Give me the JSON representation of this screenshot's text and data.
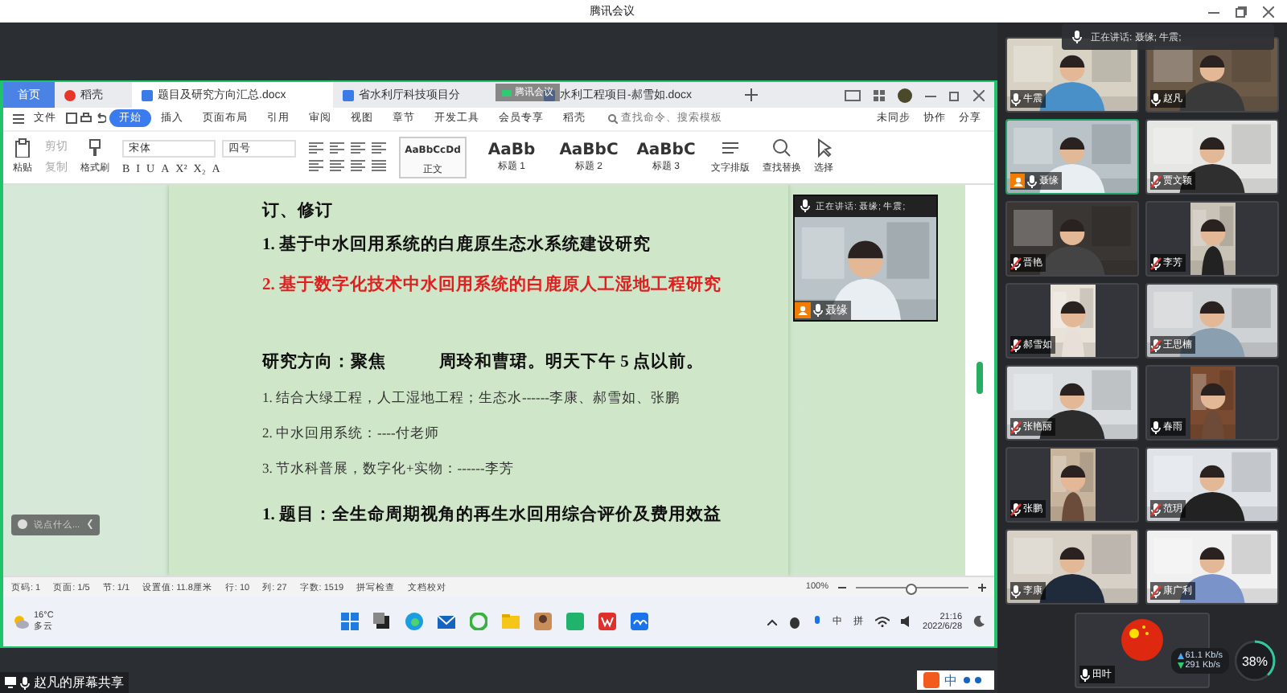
{
  "app": {
    "title": "腾讯会议"
  },
  "wps": {
    "tabs": [
      {
        "label": "首页",
        "kind": "home",
        "selected": false
      },
      {
        "label": "稻壳",
        "kind": "docer",
        "selected": false
      },
      {
        "label": "题目及研究方向汇总.docx",
        "kind": "doc",
        "selected": true
      },
      {
        "label": "省水利厅科技项目分",
        "kind": "doc",
        "selected": false
      },
      {
        "label": "水利工程项目-郝雪如.docx",
        "kind": "doc",
        "selected": false
      }
    ],
    "floating_badge": "腾讯会议",
    "file_menu": "文件",
    "menu": [
      {
        "label": "开始",
        "selected": true
      },
      {
        "label": "插入",
        "selected": false
      },
      {
        "label": "页面布局",
        "selected": false
      },
      {
        "label": "引用",
        "selected": false
      },
      {
        "label": "审阅",
        "selected": false
      },
      {
        "label": "视图",
        "selected": false
      },
      {
        "label": "章节",
        "selected": false
      },
      {
        "label": "开发工具",
        "selected": false
      },
      {
        "label": "会员专享",
        "selected": false
      },
      {
        "label": "稻壳",
        "selected": false
      }
    ],
    "search": {
      "placeholder": "查找命令、搜索模板"
    },
    "menu_right": [
      "未同步",
      "协作",
      "分享"
    ],
    "ribbon": {
      "paste": "粘贴",
      "cut": "剪切",
      "copy": "复制",
      "format_painter": "格式刷",
      "font": "宋体",
      "size": "四号",
      "format_glyphs": [
        "B",
        "I",
        "U",
        "A",
        "X²",
        "X₂",
        "A"
      ],
      "styles": [
        {
          "sample": "AaBbCcDd",
          "label": "正文",
          "selected": true
        },
        {
          "sample": "AaBb",
          "label": "标题 1",
          "selected": false
        },
        {
          "sample": "AaBbC",
          "label": "标题 2",
          "selected": false
        },
        {
          "sample": "AaBbC",
          "label": "标题 3",
          "selected": false
        }
      ],
      "tools": [
        "文字排版",
        "查找替换",
        "选择"
      ]
    },
    "document": {
      "lines": [
        {
          "text": "订、修订",
          "kind": "bold"
        },
        {
          "text": "1. 基于中水回用系统的白鹿原生态水系统建设研究",
          "kind": "bold"
        },
        {
          "text": "2. 基于数字化技术中水回用系统的白鹿原人工湿地工程研究",
          "kind": "red"
        },
        {
          "text": "研究方向：聚焦　　　周玲和曹珺。明天下午 5 点以前。",
          "kind": "section"
        },
        {
          "text": "1. 结合大绿工程，人工湿地工程；生态水------李康、郝雪如、张鹏",
          "kind": "plain"
        },
        {
          "text": "2. 中水回用系统：----付老师",
          "kind": "plain"
        },
        {
          "text": "3. 节水科普展，数字化+实物：------李芳",
          "kind": "plain"
        },
        {
          "text": "1. 题目：全生命周期视角的再生水回用综合评价及费用效益",
          "kind": "section"
        }
      ]
    },
    "comment_box": {
      "placeholder": "说点什么..."
    },
    "status_bar": [
      "页码: 1",
      "页面: 1/5",
      "节: 1/1",
      "设置值: 11.8厘米",
      "行: 10",
      "列: 27",
      "字数: 1519"
    ],
    "status_tools": [
      "拼写检查",
      "文档校对"
    ],
    "zoom": {
      "reading": "100%",
      "level": 0.48
    }
  },
  "taskbar": {
    "temperature": "16°C",
    "weather": "多云",
    "ime": [
      "中",
      "拼"
    ],
    "time": "21:16",
    "date": "2022/6/28"
  },
  "floating_video": {
    "speaking": "正在讲话: 聂缘; 牛震;",
    "name": "聂缘",
    "host": true
  },
  "speaking_banner": "正在讲话: 聂缘; 牛震;",
  "participants": [
    {
      "name": "牛震",
      "kind": "video",
      "muted": false,
      "host": false,
      "speaking": false
    },
    {
      "name": "赵凡",
      "kind": "video",
      "muted": false,
      "host": false,
      "speaking": false
    },
    {
      "name": "聂缘",
      "kind": "video",
      "muted": false,
      "host": true,
      "speaking": true
    },
    {
      "name": "贾文颖",
      "kind": "video",
      "muted": true,
      "host": false,
      "speaking": false
    },
    {
      "name": "晋艳",
      "kind": "video",
      "muted": true,
      "host": false,
      "speaking": false
    },
    {
      "name": "李芳",
      "kind": "portrait",
      "muted": true,
      "host": false,
      "speaking": false
    },
    {
      "name": "郝雪如",
      "kind": "portrait",
      "muted": true,
      "host": false,
      "speaking": false
    },
    {
      "name": "王思楠",
      "kind": "video",
      "muted": true,
      "host": false,
      "speaking": false
    },
    {
      "name": "张艳丽",
      "kind": "video",
      "muted": true,
      "host": false,
      "speaking": false
    },
    {
      "name": "春雨",
      "kind": "portrait",
      "muted": false,
      "host": false,
      "speaking": false
    },
    {
      "name": "张鹏",
      "kind": "portrait",
      "muted": true,
      "host": false,
      "speaking": false
    },
    {
      "name": "范玥",
      "kind": "video",
      "muted": true,
      "host": false,
      "speaking": false
    },
    {
      "name": "李康",
      "kind": "video",
      "muted": false,
      "host": false,
      "speaking": false
    },
    {
      "name": "康广利",
      "kind": "video",
      "muted": true,
      "host": false,
      "speaking": false
    },
    {
      "name": "田叶",
      "kind": "avatar",
      "muted": false,
      "host": false,
      "speaking": false
    }
  ],
  "network": {
    "upload": "61.1 Kb/s",
    "download": "291 Kb/s",
    "cpu": "38%",
    "level": 0.38
  },
  "share_label": "赵凡的屏幕共享",
  "ime_bar": "中"
}
